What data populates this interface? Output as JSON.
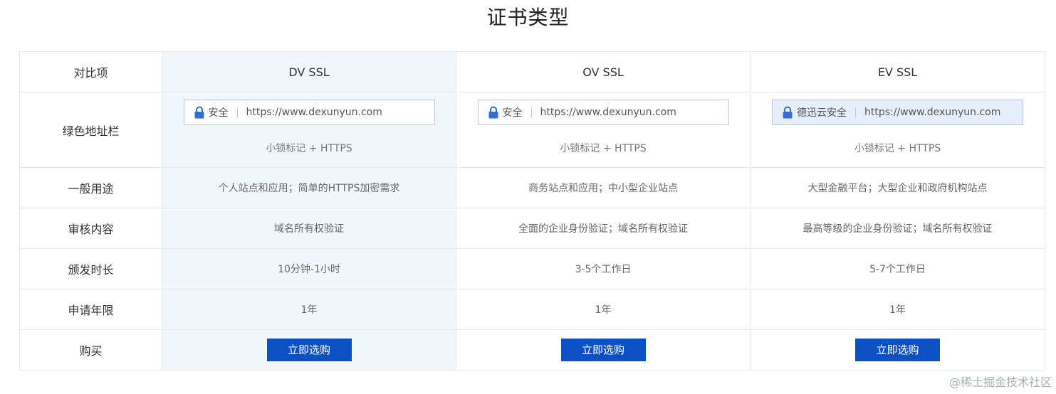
{
  "page": {
    "title": "证书类型"
  },
  "table": {
    "header": {
      "label": "对比项",
      "plans": [
        "DV SSL",
        "OV SSL",
        "EV SSL"
      ]
    },
    "address_bar_row": {
      "label": "绿色地址栏",
      "bars": [
        {
          "secure_text": "安全",
          "url": "https://www.dexunyun.com",
          "note": "小锁标记 + HTTPS"
        },
        {
          "secure_text": "安全",
          "url": "https://www.dexunyun.com",
          "note": "小锁标记 + HTTPS"
        },
        {
          "secure_text": "德迅云安全",
          "url": "https://www.dexunyun.com",
          "note": "小锁标记 + HTTPS"
        }
      ]
    },
    "rows": [
      {
        "label": "一般用途",
        "values": [
          "个人站点和应用；简单的HTTPS加密需求",
          "商务站点和应用；中小型企业站点",
          "大型金融平台；大型企业和政府机构站点"
        ]
      },
      {
        "label": "审核内容",
        "values": [
          "域名所有权验证",
          "全面的企业身份验证；域名所有权验证",
          "最高等级的企业身份验证；域名所有权验证"
        ]
      },
      {
        "label": "颁发时长",
        "values": [
          "10分钟-1小时",
          "3-5个工作日",
          "5-7个工作日"
        ]
      },
      {
        "label": "申请年限",
        "values": [
          "1年",
          "1年",
          "1年"
        ]
      }
    ],
    "buy_row": {
      "label": "购买",
      "buttons": [
        "立即选购",
        "立即选购",
        "立即选购"
      ]
    }
  },
  "watermark": "@稀土掘金技术社区",
  "colors": {
    "highlight_column": "#f1f6fd",
    "button": "#0b51c5",
    "lock": "#2f6fd6",
    "ev_bar": "#e7eefb"
  },
  "icons": {
    "lock": "lock-icon"
  }
}
